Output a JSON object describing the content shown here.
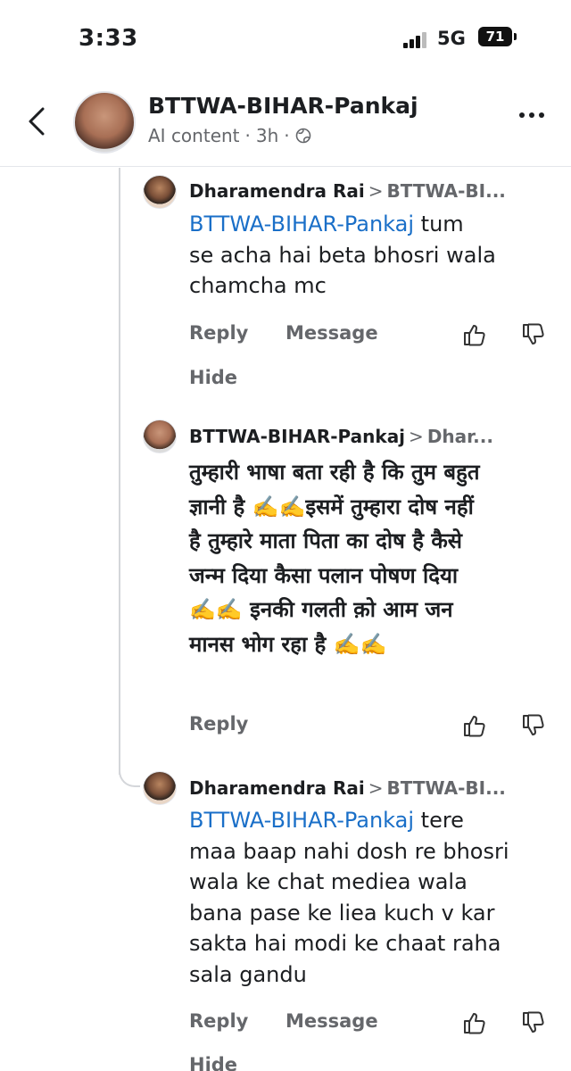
{
  "status_bar": {
    "time": "3:33",
    "network": "5G",
    "battery": "71"
  },
  "header": {
    "name": "BTTWA-BIHAR-Pankaj",
    "label": "AI content",
    "dot": "·",
    "age": "3h",
    "dot2": "·"
  },
  "comments": [
    {
      "author": "Dharamendra Rai",
      "arrow": ">",
      "reply_to": "BTTWA-BI...",
      "mention": "BTTWA-BIHAR-Pankaj",
      "lines": [
        "tum",
        "se acha hai beta  bhosri wala",
        "chamcha mc"
      ],
      "reply_label": "Reply",
      "message_label": "Message",
      "hide_label": "Hide"
    },
    {
      "author": "BTTWA-BIHAR-Pankaj",
      "arrow": ">",
      "reply_to": "Dhar...",
      "lines": [
        "तुम्हारी भाषा बता रही है कि तुम बहुत",
        "ज्ञानी है ✍️✍️इसमें तुम्हारा दोष नहीं",
        "है तुम्हारे माता पिता का दोष है कैसे",
        "जन्म दिया कैसा पलान पोषण दिया",
        "✍️✍️ इनकी गलती क़ो आम जन",
        "मानस भोग रहा है ✍️✍️"
      ],
      "reply_label": "Reply"
    },
    {
      "author": "Dharamendra Rai",
      "arrow": ">",
      "reply_to": "BTTWA-BI...",
      "mention": "BTTWA-BIHAR-Pankaj",
      "lines": [
        "tere",
        "maa baap nahi dosh re bhosri",
        "wala ke chat mediea wala",
        "bana pase ke liea kuch v kar",
        "sakta hai modi ke chaat raha",
        "sala gandu"
      ],
      "reply_label": "Reply",
      "message_label": "Message",
      "hide_label": "Hide"
    }
  ],
  "icons": {
    "back": "chevron-left-icon",
    "more": "more-horizontal-icon",
    "globe": "globe-icon",
    "like": "thumbs-up-icon",
    "dislike": "thumbs-down-icon"
  },
  "colors": {
    "mention": "#1a6fc8",
    "muted": "#65676b",
    "text": "#1c1e21"
  }
}
